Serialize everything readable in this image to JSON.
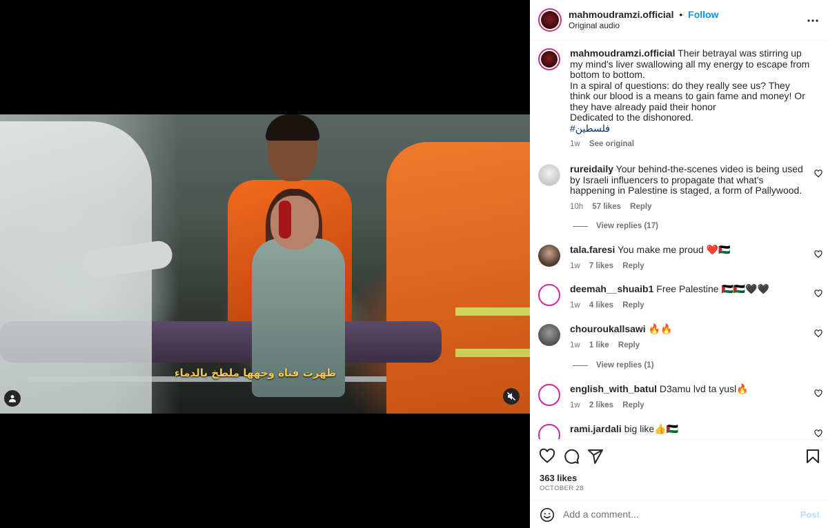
{
  "post": {
    "username": "mahmoudramzi.official",
    "separator": "•",
    "follow_label": "Follow",
    "audio": "Original audio",
    "more_label": "•••"
  },
  "media": {
    "subtitle": "ظهرت فتاة وجهها ملطخ بالدماء",
    "muted": true
  },
  "caption": {
    "username": "mahmoudramzi.official",
    "line1": "Their betrayal was stirring up my mind's liver swallowing all my energy to escape from bottom to bottom.",
    "line2": "In a spiral of questions: do they really see us? They think our blood is a means to gain fame and money! Or they have already paid their honor",
    "line3": "Dedicated to the dishonored.",
    "hashtag": "#فلسطين",
    "time": "1w",
    "see_original": "See original"
  },
  "comments": [
    {
      "username": "rureidaily",
      "text": "Your behind-the-scenes video is being used by Israeli influencers to propagate that what's happening in Palestine is staged, a form of Pallywood.",
      "time": "10h",
      "likes": "57 likes",
      "reply": "Reply",
      "view_replies": "View replies (17)"
    },
    {
      "username": "tala.faresi",
      "text": "You make me proud ❤️🇵🇸",
      "time": "1w",
      "likes": "7 likes",
      "reply": "Reply"
    },
    {
      "username": "deemah__shuaib1",
      "text": "Free Palestine 🇵🇸🇵🇸🖤🖤",
      "time": "1w",
      "likes": "4 likes",
      "reply": "Reply"
    },
    {
      "username": "chouroukallsawi",
      "text": "🔥🔥",
      "time": "1w",
      "likes": "1 like",
      "reply": "Reply",
      "view_replies": "View replies (1)"
    },
    {
      "username": "english_with_batul",
      "text": "D3amu lvd ta yusl🔥",
      "time": "1w",
      "likes": "2 likes",
      "reply": "Reply"
    },
    {
      "username": "rami.jardali",
      "text": "big like👍🇵🇸",
      "time": "",
      "likes": "",
      "reply": ""
    }
  ],
  "stats": {
    "likes": "363 likes",
    "date": "OCTOBER 28"
  },
  "composer": {
    "placeholder": "Add a comment...",
    "post_label": "Post"
  },
  "colors": {
    "accent": "#0095f6",
    "text": "#262626",
    "secondary": "#737373",
    "post_disabled": "#b2dffc",
    "story_ring": "#c13584"
  }
}
